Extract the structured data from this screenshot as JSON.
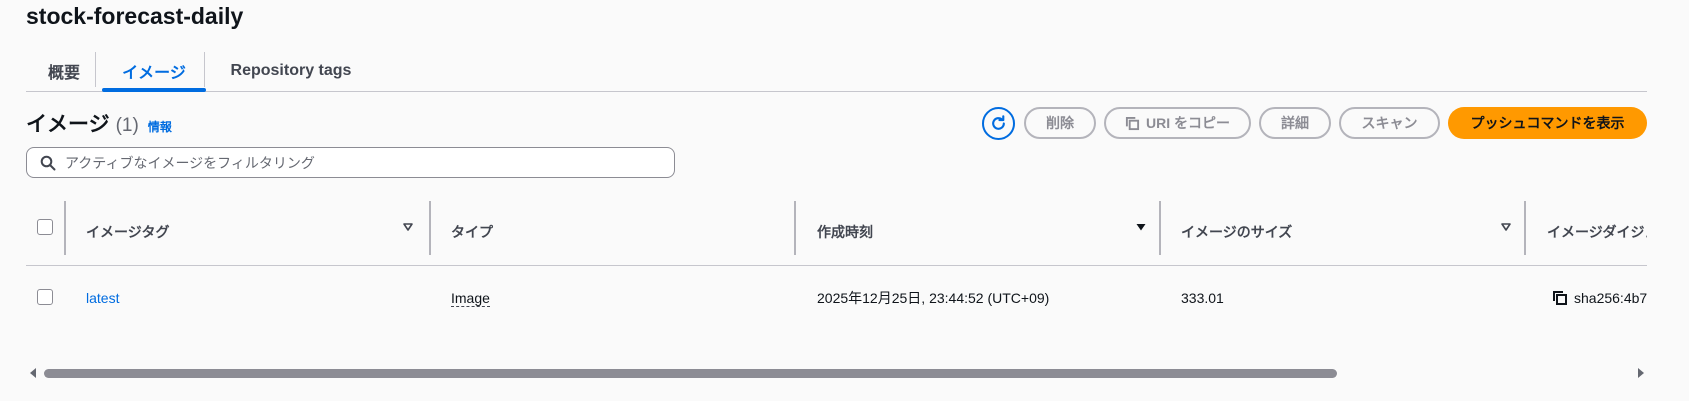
{
  "repository": {
    "name": "stock-forecast-daily"
  },
  "tabs": [
    {
      "label": "概要"
    },
    {
      "label": "イメージ"
    },
    {
      "label": "Repository tags"
    }
  ],
  "section": {
    "title": "イメージ",
    "count": "(1)",
    "info": "情報"
  },
  "toolbar": {
    "delete_label": "削除",
    "copy_uri_label": "URI をコピー",
    "details_label": "詳細",
    "scan_label": "スキャン",
    "push_commands_label": "プッシュコマンドを表示"
  },
  "filter": {
    "placeholder": "アクティブなイメージをフィルタリング",
    "value": ""
  },
  "table": {
    "columns": [
      "イメージタグ",
      "タイプ",
      "作成時刻",
      "イメージのサイズ",
      "イメージダイジェスト"
    ],
    "rows": [
      {
        "tag": "latest",
        "type": "Image",
        "created": "2025年12月25日, 23:44:52 (UTC+09)",
        "size": "333.01",
        "digest": "sha256:4b7"
      }
    ]
  },
  "colors": {
    "accent": "#006ce0",
    "primary_button": "#ff9900",
    "disabled_text": "#8c8c94"
  }
}
